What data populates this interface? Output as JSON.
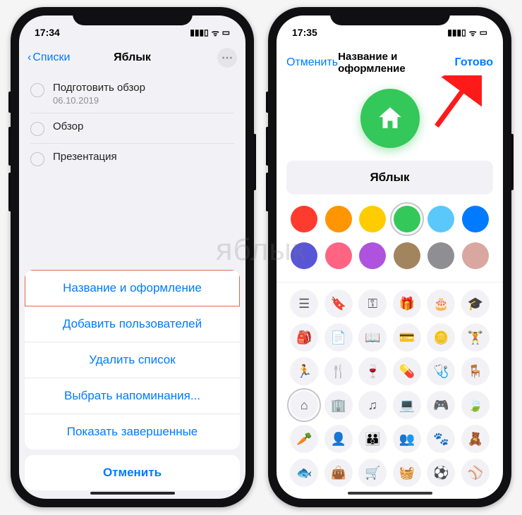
{
  "watermark": "яблык",
  "left": {
    "time": "17:34",
    "back_label": "Списки",
    "title": "Яблык",
    "reminders": [
      {
        "title": "Подготовить обзор",
        "date": "06.10.2019"
      },
      {
        "title": "Обзор",
        "date": ""
      },
      {
        "title": "Презентация",
        "date": ""
      }
    ],
    "sheet": {
      "name_style": "Название и оформление",
      "add_users": "Добавить пользователей",
      "delete_list": "Удалить список",
      "select_reminders": "Выбрать напоминания...",
      "show_completed": "Показать завершенные",
      "cancel": "Отменить"
    }
  },
  "right": {
    "time": "17:35",
    "cancel": "Отменить",
    "title": "Название и оформление",
    "done": "Готово",
    "name_value": "Яблык",
    "colors": [
      {
        "name": "red",
        "hex": "#ff3b30"
      },
      {
        "name": "orange",
        "hex": "#ff9500"
      },
      {
        "name": "yellow",
        "hex": "#ffcc00"
      },
      {
        "name": "green",
        "hex": "#34c759",
        "selected": true
      },
      {
        "name": "lightblue",
        "hex": "#5ac8fa"
      },
      {
        "name": "blue",
        "hex": "#007aff"
      },
      {
        "name": "indigo",
        "hex": "#5856d6"
      },
      {
        "name": "pink",
        "hex": "#ff6482"
      },
      {
        "name": "purple",
        "hex": "#af52de"
      },
      {
        "name": "brown",
        "hex": "#a2845e"
      },
      {
        "name": "gray",
        "hex": "#8e8e93"
      },
      {
        "name": "rose",
        "hex": "#d9a6a0"
      }
    ],
    "icons": [
      {
        "name": "list-icon",
        "glyph": "☰"
      },
      {
        "name": "bookmark-icon",
        "glyph": "🔖"
      },
      {
        "name": "key-icon",
        "glyph": "⚿"
      },
      {
        "name": "gift-icon",
        "glyph": "🎁"
      },
      {
        "name": "cake-icon",
        "glyph": "🎂"
      },
      {
        "name": "graduation-icon",
        "glyph": "🎓"
      },
      {
        "name": "backpack-icon",
        "glyph": "🎒"
      },
      {
        "name": "document-icon",
        "glyph": "📄"
      },
      {
        "name": "book-icon",
        "glyph": "📖"
      },
      {
        "name": "card-icon",
        "glyph": "💳"
      },
      {
        "name": "coins-icon",
        "glyph": "🪙"
      },
      {
        "name": "dumbbell-icon",
        "glyph": "🏋"
      },
      {
        "name": "running-icon",
        "glyph": "🏃"
      },
      {
        "name": "fork-icon",
        "glyph": "🍴"
      },
      {
        "name": "wine-icon",
        "glyph": "🍷"
      },
      {
        "name": "pills-icon",
        "glyph": "💊"
      },
      {
        "name": "stethoscope-icon",
        "glyph": "🩺"
      },
      {
        "name": "chair-icon",
        "glyph": "🪑"
      },
      {
        "name": "home-icon",
        "glyph": "⌂",
        "selected": true
      },
      {
        "name": "building-icon",
        "glyph": "🏢"
      },
      {
        "name": "music-icon",
        "glyph": "♫"
      },
      {
        "name": "laptop-icon",
        "glyph": "💻"
      },
      {
        "name": "gamepad-icon",
        "glyph": "🎮"
      },
      {
        "name": "leaf-icon",
        "glyph": "🍃"
      },
      {
        "name": "carrot-icon",
        "glyph": "🥕"
      },
      {
        "name": "person-icon",
        "glyph": "👤"
      },
      {
        "name": "family-icon",
        "glyph": "👪"
      },
      {
        "name": "group-icon",
        "glyph": "👥"
      },
      {
        "name": "paw-icon",
        "glyph": "🐾"
      },
      {
        "name": "teddy-icon",
        "glyph": "🧸"
      },
      {
        "name": "fish-icon",
        "glyph": "🐟"
      },
      {
        "name": "bag-icon",
        "glyph": "👜"
      },
      {
        "name": "cart-icon",
        "glyph": "🛒"
      },
      {
        "name": "basket-icon",
        "glyph": "🧺"
      },
      {
        "name": "soccer-icon",
        "glyph": "⚽"
      },
      {
        "name": "baseball-icon",
        "glyph": "⚾"
      }
    ]
  }
}
